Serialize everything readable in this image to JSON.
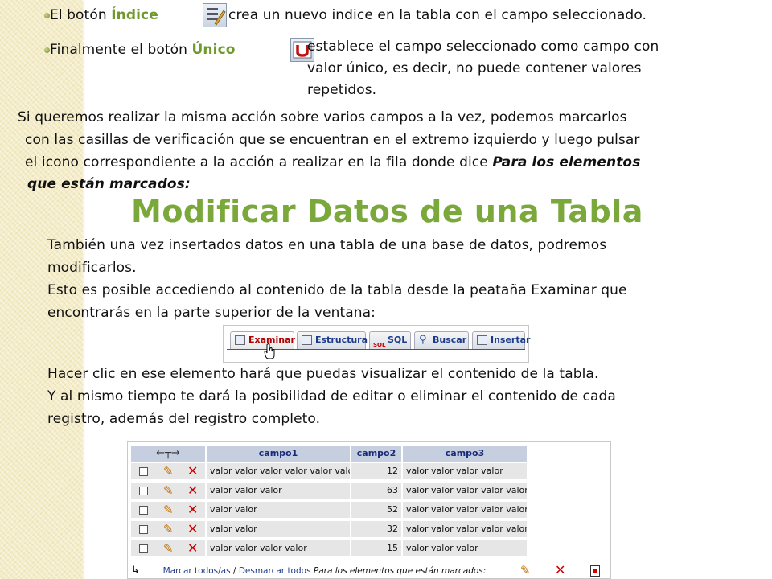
{
  "lines": {
    "indice_prefix": "El botón ",
    "indice_word": "Índice",
    "indice_desc": "crea un nuevo indice en la tabla con el campo seleccionado.",
    "unico_prefix": "Finalmente el botón ",
    "unico_word": "Único",
    "unico_desc_1": "establece el campo seleccionado como campo con",
    "unico_desc_2": "valor único, es decir, no puede contener valores",
    "unico_desc_3": "repetidos.",
    "para_1": "Si queremos realizar la misma acción sobre varios campos a la vez, podemos marcarlos",
    "para_2": "con las casillas de verificación que se encuentran en el extremo izquierdo y luego pulsar",
    "para_3_plain": "el icono correspondiente a la acción a realizar en la fila donde dice ",
    "para_3_bold": "Para los elementos",
    "para_4_bold": "que están marcados:"
  },
  "heading": "Modificar Datos de una Tabla",
  "section": {
    "p1": "También una vez insertados datos en una tabla de una base de datos, podremos",
    "p2": "modificarlos.",
    "p3": "Esto es posible accediendo al contenido de la tabla desde la peataña Examinar que",
    "p4": "encontrarás en la parte superior de la ventana:",
    "p5": "Hacer clic en ese elemento hará que puedas visualizar el contenido de la tabla.",
    "p6": "Y al mismo tiempo te dará la posibilidad de editar o eliminar el contenido de cada",
    "p7": "registro, además del registro completo."
  },
  "toolbar": {
    "tabs": [
      "Examinar",
      "Estructura",
      "SQL",
      "Buscar",
      "Insertar"
    ],
    "sql_badge": "SQL"
  },
  "table": {
    "headers": [
      "campo1",
      "campo2",
      "campo3"
    ],
    "rows": [
      {
        "campo1": "valor valor valor valor valor valor",
        "campo2": "12",
        "campo3": "valor valor valor valor"
      },
      {
        "campo1": "valor valor valor",
        "campo2": "63",
        "campo3": "valor valor valor valor valor"
      },
      {
        "campo1": "valor valor",
        "campo2": "52",
        "campo3": "valor valor valor valor valor"
      },
      {
        "campo1": "valor valor",
        "campo2": "32",
        "campo3": "valor valor valor valor valor"
      },
      {
        "campo1": "valor valor valor valor",
        "campo2": "15",
        "campo3": "valor valor valor"
      }
    ],
    "footer_mark_all": "Marcar todos/as",
    "footer_sep": " / ",
    "footer_unmark_all": "Desmarcar todos",
    "footer_selected": "Para los elementos que están marcados:"
  },
  "icons": {
    "index": "index-icon",
    "unique": "unique-icon",
    "edit": "pencil-icon",
    "delete": "delete-x-icon",
    "export": "export-icon",
    "accent": "#7aa83a",
    "label_green": "#6f9a2b",
    "link_blue": "#1b3a8a",
    "active_tab_red": "#b00000"
  }
}
